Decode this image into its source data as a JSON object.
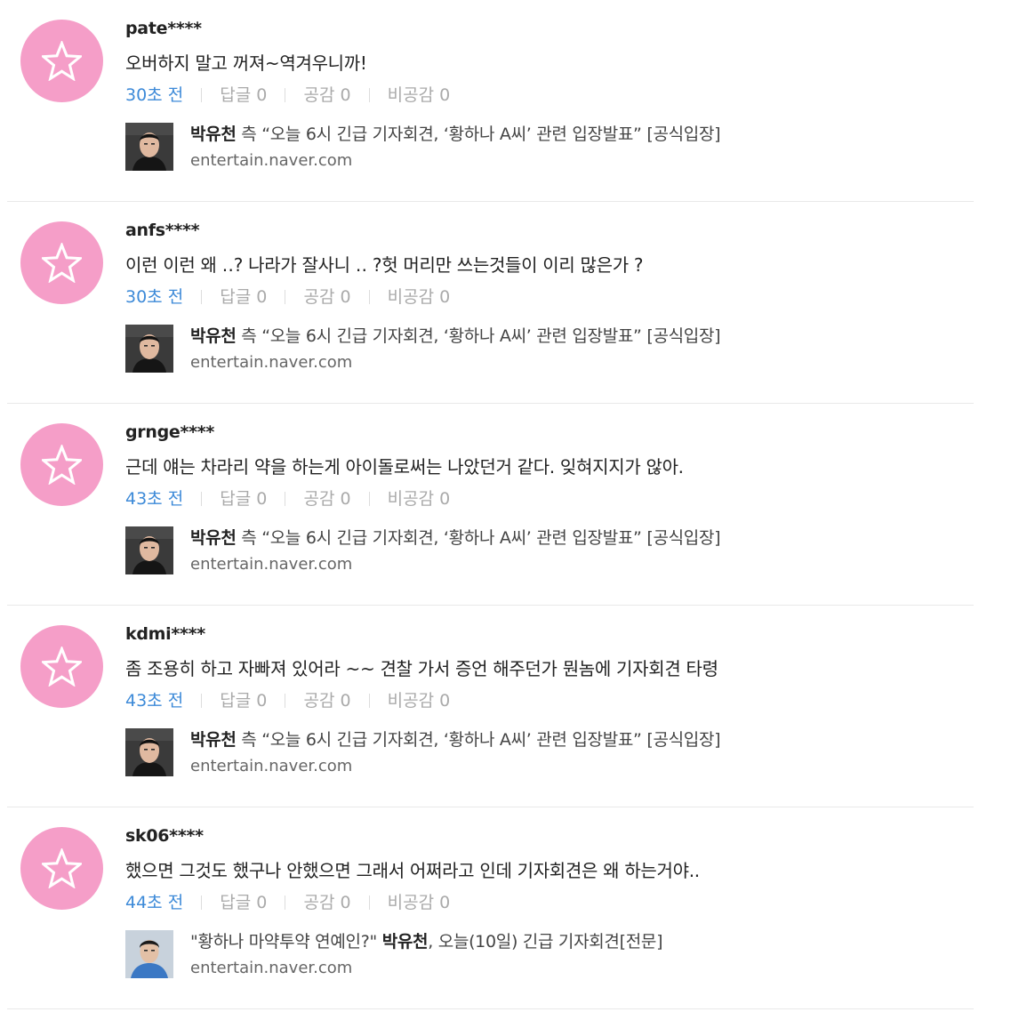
{
  "comments": [
    {
      "username": "pate****",
      "text": "오버하지 말고 꺼져~역겨우니까!",
      "time": "30초 전",
      "reply_label": "답글 0",
      "like_label": "공감 0",
      "dislike_label": "비공감 0",
      "article": {
        "title_bold": "박유천",
        "title_rest": " 측 “오늘 6시 긴급 기자회견, ‘황하나 A씨’ 관련 입장발표” [공식입장]",
        "domain": "entertain.naver.com",
        "thumb": "man-dark"
      }
    },
    {
      "username": "anfs****",
      "text": "이런 이런 왜 ‥? 나라가 잘사니 ‥ ?헛 머리만 쓰는것들이 이리 많은가 ?",
      "time": "30초 전",
      "reply_label": "답글 0",
      "like_label": "공감 0",
      "dislike_label": "비공감 0",
      "article": {
        "title_bold": "박유천",
        "title_rest": " 측 “오늘 6시 긴급 기자회견, ‘황하나 A씨’ 관련 입장발표” [공식입장]",
        "domain": "entertain.naver.com",
        "thumb": "man-dark"
      }
    },
    {
      "username": "grnge****",
      "text": "근데 얘는 차라리 약을 하는게 아이돌로써는 나았던거 같다. 잊혀지지가 않아.",
      "time": "43초 전",
      "reply_label": "답글 0",
      "like_label": "공감 0",
      "dislike_label": "비공감 0",
      "article": {
        "title_bold": "박유천",
        "title_rest": " 측 “오늘 6시 긴급 기자회견, ‘황하나 A씨’ 관련 입장발표” [공식입장]",
        "domain": "entertain.naver.com",
        "thumb": "man-dark"
      }
    },
    {
      "username": "kdmi****",
      "text": "좀 조용히 하고 자빠져 있어라 ~~ 견찰 가서 증언 해주던가 뭔놈에 기자회견 타령",
      "time": "43초 전",
      "reply_label": "답글 0",
      "like_label": "공감 0",
      "dislike_label": "비공감 0",
      "article": {
        "title_bold": "박유천",
        "title_rest": " 측 “오늘 6시 긴급 기자회견, ‘황하나 A씨’ 관련 입장발표” [공식입장]",
        "domain": "entertain.naver.com",
        "thumb": "man-dark"
      }
    },
    {
      "username": "sk06****",
      "text": "했으면 그것도 했구나 안했으면 그래서 어쩌라고 인데 기자회견은 왜 하는거야..",
      "time": "44초 전",
      "reply_label": "답글 0",
      "like_label": "공감 0",
      "dislike_label": "비공감 0",
      "article": {
        "title_pre": "\"황하나 마약투약 연예인?\" ",
        "title_bold": "박유천",
        "title_rest": ", 오늘(10일) 긴급 기자회견[전문]",
        "domain": "entertain.naver.com",
        "thumb": "man-blue"
      }
    }
  ],
  "colors": {
    "avatar_pink": "#f59ec8",
    "time_blue": "#3d8ad8",
    "meta_gray": "#aaaaaa"
  },
  "icons": {
    "avatar": "star-outline-icon"
  }
}
